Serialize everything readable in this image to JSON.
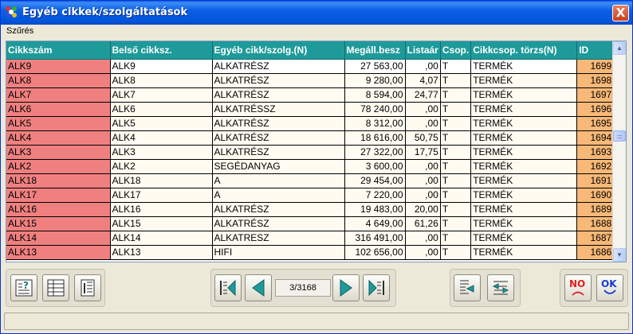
{
  "window": {
    "title": "Egyéb cikkek/szolgáltatások",
    "close_label": "X"
  },
  "menu": {
    "items": [
      "Szűrés"
    ]
  },
  "grid": {
    "columns": [
      "Cikkszám",
      "Belső cikksz.",
      "Egyéb cikk/szolg.(N)",
      "Megáll.besz",
      "Listaár",
      "Csop.",
      "Cikkcsop. törzs(N)",
      "ID"
    ],
    "rows": [
      [
        "ALK9",
        "ALK9",
        "ALKATRÉSZ",
        "27 563,00",
        ",00",
        "T",
        "TERMÉK",
        "1699"
      ],
      [
        "ALK8",
        "ALK8",
        "ALKATRÉSZ",
        "9 280,00",
        "4,07",
        "T",
        "TERMÉK",
        "1698"
      ],
      [
        "ALK7",
        "ALK7",
        "ALKATRÉSZ",
        "8 594,00",
        "24,77",
        "T",
        "TERMÉK",
        "1697"
      ],
      [
        "ALK6",
        "ALK6",
        "ALKATRÉSSZ",
        "78 240,00",
        ",00",
        "T",
        "TERMÉK",
        "1696"
      ],
      [
        "ALK5",
        "ALK5",
        "ALKATRÉSZ",
        "8 312,00",
        ",00",
        "T",
        "TERMÉK",
        "1695"
      ],
      [
        "ALK4",
        "ALK4",
        "ALKATRÉSZ",
        "18 616,00",
        "50,75",
        "T",
        "TERMÉK",
        "1694"
      ],
      [
        "ALK3",
        "ALK3",
        "ALKATRÉSZ",
        "27 322,00",
        "17,75",
        "T",
        "TERMÉK",
        "1693"
      ],
      [
        "ALK2",
        "ALK2",
        "SEGÉDANYAG",
        "3 600,00",
        ",00",
        "T",
        "TERMÉK",
        "1692"
      ],
      [
        "ALK18",
        "ALK18",
        "A",
        "29 454,00",
        ",00",
        "T",
        "TERMÉK",
        "1691"
      ],
      [
        "ALK17",
        "ALK17",
        "A",
        "7 220,00",
        ",00",
        "T",
        "TERMÉK",
        "1690"
      ],
      [
        "ALK16",
        "ALK16",
        "ALKATRÉSZ",
        "19 483,00",
        "20,00",
        "T",
        "TERMÉK",
        "1689"
      ],
      [
        "ALK15",
        "ALK15",
        "ALKATRÉSZ",
        "4 649,00",
        "61,26",
        "T",
        "TERMÉK",
        "1688"
      ],
      [
        "ALK14",
        "ALK14",
        "ALKATRESZ",
        "316 491,00",
        ",00",
        "T",
        "TERMÉK",
        "1687"
      ],
      [
        "ALK13",
        "ALK13",
        "HIFI",
        "102 656,00",
        ",00",
        "T",
        "TERMÉK",
        "1686"
      ]
    ]
  },
  "pager": {
    "position": "3/3168"
  },
  "buttons": {
    "left": [
      "help-search-icon",
      "table-view-icon",
      "record-view-icon"
    ],
    "nav": [
      "first-record-icon",
      "previous-record-icon",
      "next-record-icon",
      "last-record-icon"
    ],
    "edit": [
      "edit-record-icon",
      "swap-record-icon"
    ],
    "confirm": [
      {
        "label": "NO",
        "icon": "sad-face-icon"
      },
      {
        "label": "OK",
        "icon": "smile-face-icon"
      }
    ]
  },
  "colors": {
    "header_bg": "#1f9a9a",
    "key_col_bg": "#f08080",
    "id_col_bg": "#f7b878",
    "titlebar": "#0a5fe6"
  }
}
